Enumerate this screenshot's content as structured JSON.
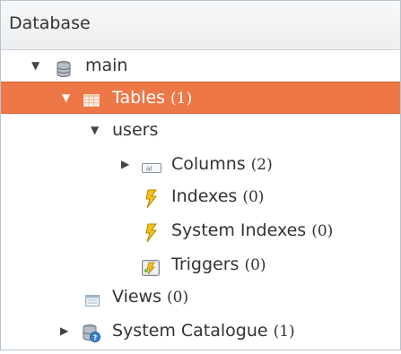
{
  "panel": {
    "title": "Database"
  },
  "tree": {
    "main": {
      "label": "main",
      "icon": "database-icon"
    },
    "tables": {
      "label": "Tables",
      "count": "(1)",
      "icon": "table-icon"
    },
    "users": {
      "label": "users"
    },
    "columns": {
      "label": "Columns",
      "count": "(2)",
      "icon": "columns-icon"
    },
    "indexes": {
      "label": "Indexes",
      "count": "(0)",
      "icon": "lightning-icon"
    },
    "system_indexes": {
      "label": "System Indexes",
      "count": "(0)",
      "icon": "lightning-icon"
    },
    "triggers": {
      "label": "Triggers",
      "count": "(0)",
      "icon": "trigger-icon"
    },
    "views": {
      "label": "Views",
      "count": "(0)",
      "icon": "view-icon"
    },
    "system_catalogue": {
      "label": "System Catalogue",
      "count": "(1)",
      "icon": "catalogue-icon"
    }
  },
  "colors": {
    "selection": "#ee7747",
    "panel_border": "#b8c4d0",
    "text": "#333333"
  }
}
